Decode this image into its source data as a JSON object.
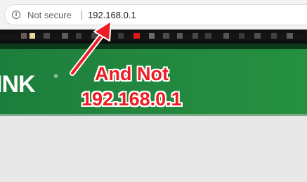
{
  "address_bar": {
    "security_label": "Not secure",
    "url": "192.168.0.1"
  },
  "router_page": {
    "logo_text": "INK",
    "logo_reg_mark": "®"
  },
  "annotation": {
    "line1": "And Not",
    "line2": "192.168.0.1",
    "color": "#ee1c23"
  },
  "colors": {
    "header_green": "#23863f",
    "bookmarks_bar": "#111111"
  }
}
